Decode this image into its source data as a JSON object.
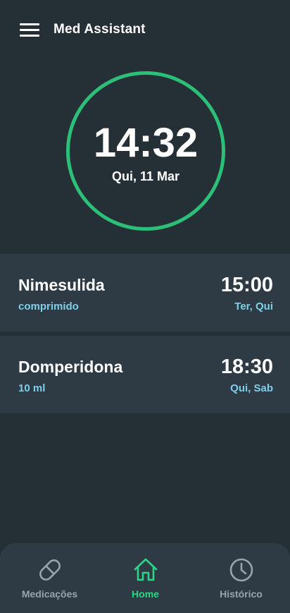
{
  "header": {
    "title": "Med Assistant",
    "menu_icon": "hamburger-menu-icon"
  },
  "clock": {
    "time": "14:32",
    "date": "Qui, 11 Mar",
    "ring_color": "#2cbf78"
  },
  "medications": [
    {
      "name": "Nimesulida",
      "dose": "comprimido",
      "time": "15:00",
      "days": "Ter, Qui"
    },
    {
      "name": "Domperidona",
      "dose": "10 ml",
      "time": "18:30",
      "days": "Qui, Sab"
    }
  ],
  "nav": {
    "items": [
      {
        "label": "Medicações",
        "icon": "pill-icon",
        "active": false
      },
      {
        "label": "Home",
        "icon": "home-icon",
        "active": true
      },
      {
        "label": "Histórico",
        "icon": "clock-history-icon",
        "active": false
      }
    ]
  },
  "colors": {
    "background": "#252f36",
    "card": "#2e3b45",
    "accent_green": "#2cd586",
    "accent_blue": "#7fcfe8",
    "inactive": "#9aa3a9"
  }
}
